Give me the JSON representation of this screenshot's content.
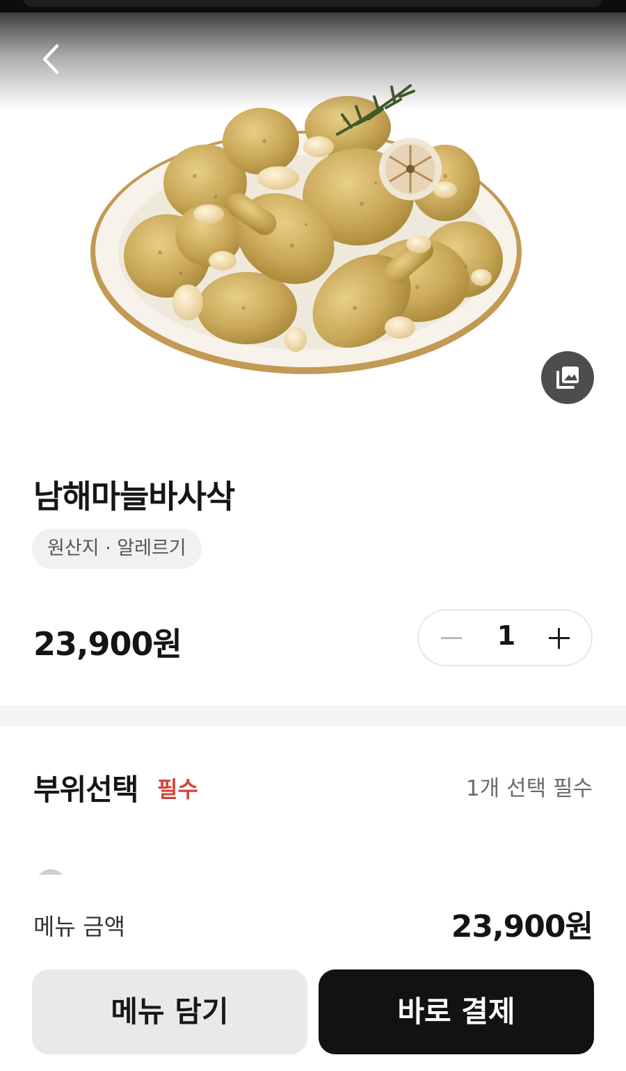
{
  "header": {
    "back_icon": "chevron-left-icon"
  },
  "hero": {
    "image_alt": "garlic fried chicken on plate",
    "gallery_icon": "photo-gallery-icon"
  },
  "product": {
    "title": "남해마늘바사삭",
    "info_chip": "원산지 · 알레르기",
    "price": "23,900원",
    "quantity": "1"
  },
  "options": {
    "title": "부위선택",
    "required": "필수",
    "hint": "1개 선택 필수"
  },
  "footer": {
    "total_label": "메뉴 금액",
    "total_amount": "23,900원",
    "add_cart_label": "메뉴 담기",
    "buy_now_label": "바로 결제"
  },
  "colors": {
    "required_red": "#d2453a",
    "primary_black": "#121212",
    "secondary_gray": "#e9e9ec"
  }
}
